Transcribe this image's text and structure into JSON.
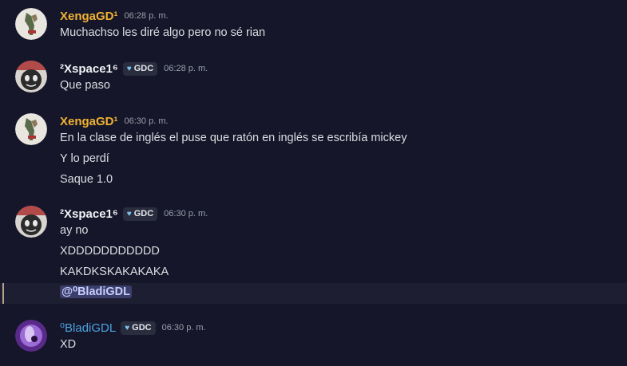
{
  "messages": [
    {
      "user": "XengaGD¹",
      "time": "06:28 p. m.",
      "lines": [
        "Muchachso les diré algo pero no sé rian"
      ]
    },
    {
      "user": "²Xspace1⁶",
      "tag": "GDC",
      "time": "06:28 p. m.",
      "lines": [
        "Que paso"
      ]
    },
    {
      "user": "XengaGD¹",
      "time": "06:30 p. m.",
      "lines": [
        "En la clase de inglés el puse que ratón en inglés se escribía mickey",
        "Y lo perdí",
        "Saque 1.0"
      ]
    },
    {
      "user": "²Xspace1⁶",
      "tag": "GDC",
      "time": "06:30 p. m.",
      "lines": [
        "ay no",
        "XDDDDDDDDDDD",
        "KAKDKSKAKAKAKA",
        "@⁰BladiGDL"
      ]
    },
    {
      "user": "⁰BladiGDL",
      "tag": "GDC",
      "time": "06:30 p. m.",
      "lines": [
        "XD"
      ]
    }
  ],
  "colors": {
    "xenga": "#f0b232",
    "xspace": "#f2f3f5",
    "bladi": "#4aa3e0",
    "mention_bg": "#3a3e6a"
  },
  "icons": {
    "tag_icon": "heart-shield-icon"
  }
}
